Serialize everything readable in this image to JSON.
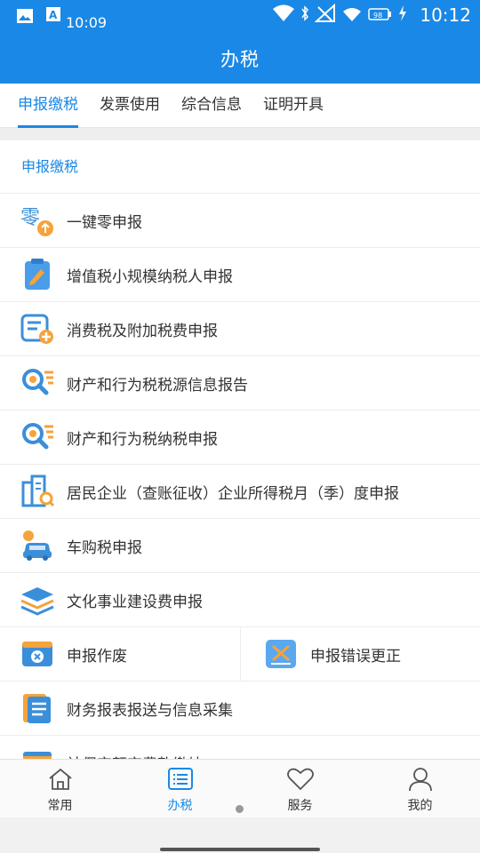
{
  "statusbar": {
    "time_left": "10:09",
    "clock": "10:12",
    "battery_text": "98"
  },
  "appbar": {
    "title": "办税"
  },
  "tabs": [
    {
      "label": "申报缴税"
    },
    {
      "label": "发票使用"
    },
    {
      "label": "综合信息"
    },
    {
      "label": "证明开具"
    }
  ],
  "section": {
    "title": "申报缴税"
  },
  "items": [
    {
      "label": "一键零申报",
      "icon": "zero-upload-icon"
    },
    {
      "label": "增值税小规模纳税人申报",
      "icon": "clipboard-pen-icon"
    },
    {
      "label": "消费税及附加税费申报",
      "icon": "form-plus-icon"
    },
    {
      "label": "财产和行为税税源信息报告",
      "icon": "search-list-icon"
    },
    {
      "label": "财产和行为税纳税申报",
      "icon": "search-list-icon"
    },
    {
      "label": "居民企业（查账征收）企业所得税月（季）度申报",
      "icon": "building-search-icon"
    },
    {
      "label": "车购税申报",
      "icon": "car-icon"
    },
    {
      "label": "文化事业建设费申报",
      "icon": "layers-icon"
    },
    {
      "label": "申报作废",
      "icon": "window-cancel-icon"
    },
    {
      "label": "申报错误更正",
      "icon": "correction-icon"
    },
    {
      "label": "财务报表报送与信息采集",
      "icon": "report-doc-icon"
    },
    {
      "label": "社保定额定费款缴纳",
      "icon": "card-icon"
    }
  ],
  "bottom_nav": [
    {
      "label": "常用",
      "icon": "home-icon"
    },
    {
      "label": "办税",
      "icon": "list-icon"
    },
    {
      "label": "服务",
      "icon": "heart-icon"
    },
    {
      "label": "我的",
      "icon": "user-icon"
    }
  ],
  "colors": {
    "primary": "#1a88e6",
    "accent_orange": "#f5a33b"
  }
}
